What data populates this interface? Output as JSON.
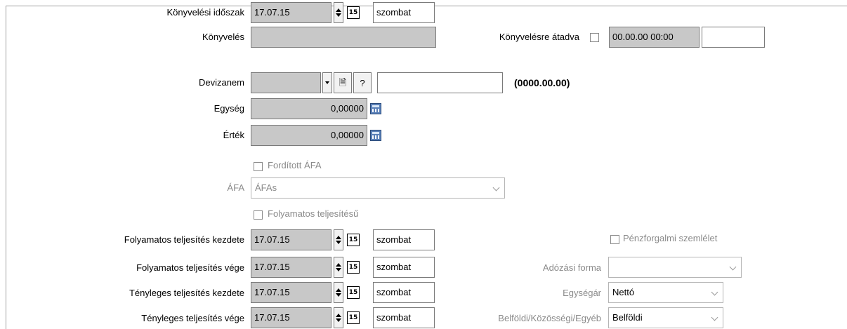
{
  "labels": {
    "konyvelesi_idoszak": "Könyvelési időszak",
    "konyveles": "Könyvelés",
    "devizanem": "Devizanem",
    "egyseg": "Egység",
    "ertek": "Érték",
    "afa": "ÁFA",
    "folyamatos_kezdete": "Folyamatos teljesítés kezdete",
    "folyamatos_vege": "Folyamatos teljesítés vége",
    "tenyleges_kezdete": "Tényleges teljesítés kezdete",
    "tenyleges_vege": "Tényleges teljesítés vége",
    "konyvelesre_atadva": "Könyvelésre átadva",
    "adozasi_forma": "Adózási forma",
    "egysegar": "Egységár",
    "belfoldi_kozossegi": "Belföldi/Közösségi/Egyéb"
  },
  "fields": {
    "konyvelesi_idoszak_date": "17.07.15",
    "konyvelesi_idoszak_day": "szombat",
    "konyveles_value": "",
    "atadva_datetime": "00.00.00 00:00",
    "atadva_extra": "",
    "devizanem_value": "",
    "devizanem_text": "",
    "devizanem_date": "(0000.00.00)",
    "egyseg_value": "0,00000",
    "ertek_value": "0,00000",
    "afa_value": "ÁFAs",
    "folyamatos_kezdete_date": "17.07.15",
    "folyamatos_kezdete_day": "szombat",
    "folyamatos_vege_date": "17.07.15",
    "folyamatos_vege_day": "szombat",
    "tenyleges_kezdete_date": "17.07.15",
    "tenyleges_kezdete_day": "szombat",
    "tenyleges_vege_date": "17.07.15",
    "tenyleges_vege_day": "szombat",
    "adozasi_forma_value": "",
    "egysegar_value": "Nettó",
    "belfoldi_value": "Belföldi"
  },
  "checkboxes": {
    "forditott_afa": "Fordított ÁFA",
    "folyamatos_teljesitesu": "Folyamatos teljesítésű",
    "penzforgalmi": "Pénzforgalmi szemlélet"
  },
  "icons": {
    "calendar_glyph": "15",
    "doc_glyph": "🗎",
    "help_glyph": "?"
  }
}
